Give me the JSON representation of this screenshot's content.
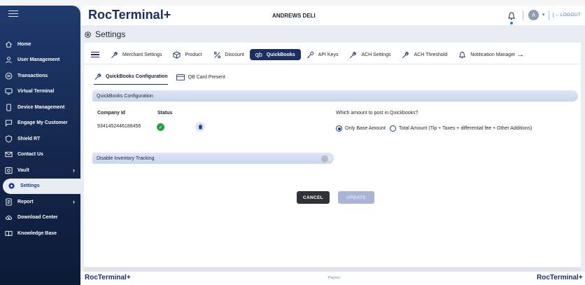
{
  "header": {
    "brand": "RocTerminal+",
    "merchant_name": "ANDREWS DELI",
    "avatar_initial": "A",
    "logout_label": "LOGOUT"
  },
  "sidebar": {
    "items": [
      {
        "label": "Home",
        "icon": "home-icon"
      },
      {
        "label": "User Management",
        "icon": "user-icon"
      },
      {
        "label": "Transactions",
        "icon": "transactions-icon"
      },
      {
        "label": "Virtual Terminal",
        "icon": "monitor-icon"
      },
      {
        "label": "Device Management",
        "icon": "device-icon"
      },
      {
        "label": "Engage My Customer",
        "icon": "chat-icon"
      },
      {
        "label": "Shield RT",
        "icon": "shield-icon"
      },
      {
        "label": "Contact Us",
        "icon": "mail-icon"
      },
      {
        "label": "Vault",
        "icon": "vault-icon"
      },
      {
        "label": "Settings",
        "icon": "gear-icon"
      },
      {
        "label": "Report",
        "icon": "report-icon"
      },
      {
        "label": "Download Center",
        "icon": "cloud-download-icon"
      },
      {
        "label": "Knowledge Base",
        "icon": "book-icon"
      }
    ],
    "active": "Settings"
  },
  "page": {
    "title": "Settings"
  },
  "tabs": [
    {
      "label": "Merchant Settings",
      "icon": "wrench-icon"
    },
    {
      "label": "Product",
      "icon": "box-icon"
    },
    {
      "label": "Discount",
      "icon": "percent-icon"
    },
    {
      "label": "QuickBooks",
      "icon": "quickbooks-icon",
      "active": true
    },
    {
      "label": "API Keys",
      "icon": "key-icon"
    },
    {
      "label": "ACH Settings",
      "icon": "wrench-icon"
    },
    {
      "label": "ACH Threshold",
      "icon": "wrench-icon"
    },
    {
      "label": "Notification Manager",
      "icon": "bell-icon"
    }
  ],
  "subtabs": [
    {
      "label": "QuickBooks Configuration",
      "active": true
    },
    {
      "label": "QB Card Present"
    }
  ],
  "config": {
    "section_title": "QuickBooks Configuration",
    "company_id_label": "Company Id",
    "status_label": "Status",
    "company_id_value": "9341452446188456",
    "question": "Which amount to post in Quickbooks?",
    "option_base": "Only Base Amount",
    "option_total": "Total Amount (Tip + Taxes + differential fee + Other Additions)",
    "selected_option": "Only Base Amount"
  },
  "inventory": {
    "label": "Disable Inventory Tracking",
    "enabled": false
  },
  "buttons": {
    "cancel": "CANCEL",
    "update": "UPDATE"
  },
  "footer": {
    "left_brand": "RocTerminal+",
    "center": "Payroc",
    "right_brand": "RocTerminal+"
  },
  "colors": {
    "brand": "#1c2f63",
    "sidebar": "#14264c",
    "accent": "#2a6bd6",
    "success": "#22a047"
  }
}
